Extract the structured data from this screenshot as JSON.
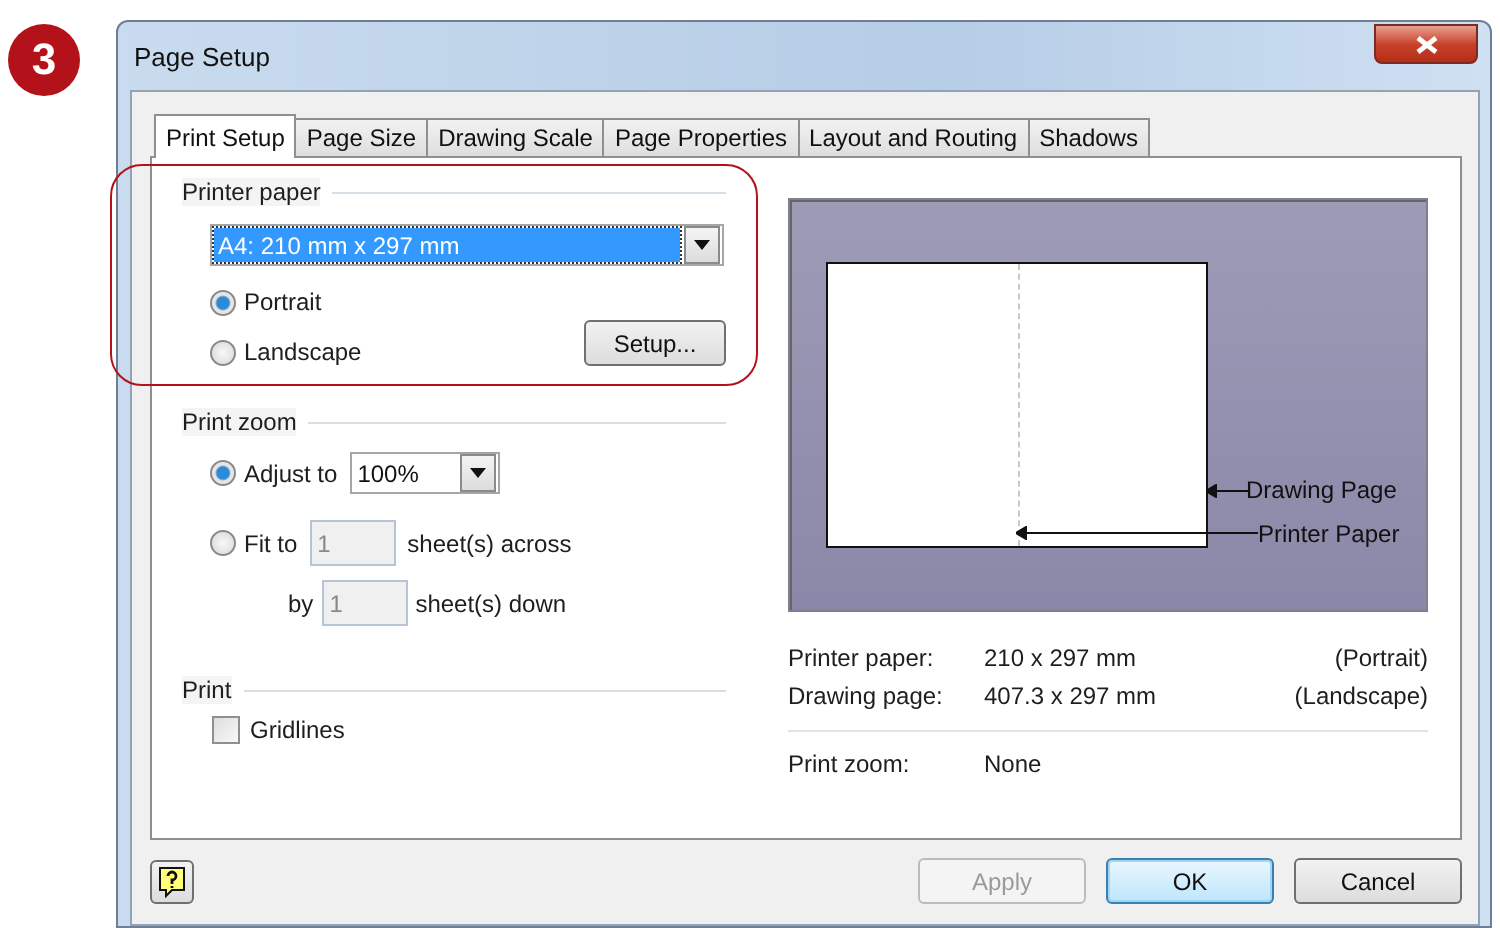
{
  "step_badge": "3",
  "window": {
    "title": "Page Setup"
  },
  "tabs": [
    {
      "label": "Print Setup",
      "selected": true
    },
    {
      "label": "Page Size",
      "selected": false
    },
    {
      "label": "Drawing Scale",
      "selected": false
    },
    {
      "label": "Page Properties",
      "selected": false
    },
    {
      "label": "Layout and Routing",
      "selected": false
    },
    {
      "label": "Shadows",
      "selected": false
    }
  ],
  "printer_paper": {
    "label": "Printer paper",
    "paper": "A4:  210 mm x 297 mm",
    "orientations": [
      {
        "label": "Portrait",
        "selected": true
      },
      {
        "label": "Landscape",
        "selected": false
      }
    ],
    "setup_button": "Setup..."
  },
  "print_zoom": {
    "label": "Print zoom",
    "adjust": {
      "label": "Adjust to",
      "selected": true,
      "value": "100%"
    },
    "fit": {
      "label": "Fit to",
      "selected": false,
      "across_value": "1",
      "across_label": "sheet(s) across",
      "by_label": "by",
      "down_value": "1",
      "down_label": "sheet(s) down"
    }
  },
  "print": {
    "label": "Print",
    "gridlines": {
      "label": "Gridlines",
      "checked": false
    }
  },
  "preview": {
    "drawing_page_label": "Drawing Page",
    "printer_paper_label": "Printer Paper"
  },
  "info": [
    {
      "label": "Printer paper:",
      "value": "210 x 297 mm",
      "orientation": "(Portrait)"
    },
    {
      "label": "Drawing page:",
      "value": "407.3 x 297 mm",
      "orientation": "(Landscape)"
    }
  ],
  "zoom_info": {
    "label": "Print zoom:",
    "value": "None"
  },
  "buttons": [
    {
      "label": "Apply",
      "disabled": true,
      "default": false
    },
    {
      "label": "OK",
      "disabled": false,
      "default": true
    },
    {
      "label": "Cancel",
      "disabled": false,
      "default": false
    }
  ]
}
